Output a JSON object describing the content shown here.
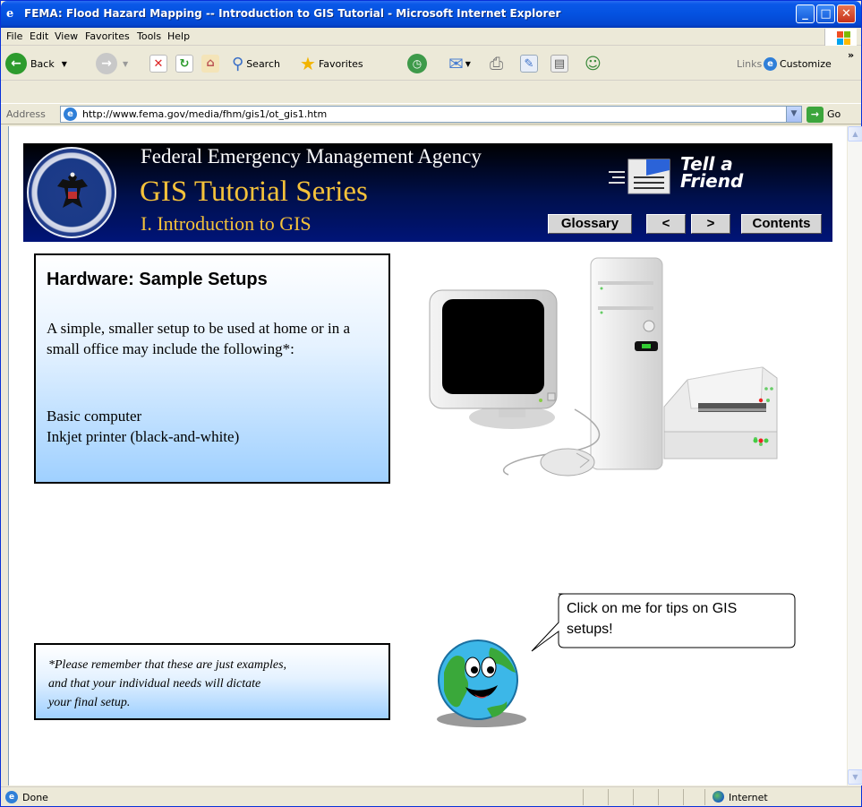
{
  "window": {
    "title": "FEMA: Flood Hazard Mapping -- Introduction to GIS Tutorial - Microsoft Internet Explorer"
  },
  "menu": {
    "items": [
      "File",
      "Edit",
      "View",
      "Favorites",
      "Tools",
      "Help"
    ]
  },
  "toolbar": {
    "back_label": "Back",
    "search_label": "Search",
    "favorites_label": "Favorites",
    "links_label": "Links",
    "customize_label": "Customize",
    "chevron": "»"
  },
  "address": {
    "label": "Address",
    "url": "http://www.fema.gov/media/fhm/gis1/ot_gis1.htm",
    "go_label": "Go"
  },
  "banner": {
    "agency": "Federal Emergency Management Agency",
    "series": "GIS Tutorial Series",
    "section": "I. Introduction to GIS",
    "tell_friend_line1": "Tell a",
    "tell_friend_line2": "Friend",
    "nav": {
      "glossary": "Glossary",
      "prev": "<",
      "next": ">",
      "contents": "Contents"
    }
  },
  "main": {
    "heading": "Hardware: Sample Setups",
    "intro": "A simple, smaller setup to be used at home or in a small office may include the following*:",
    "items": [
      "Basic computer",
      "Inkjet printer (black-and-white)"
    ]
  },
  "note": {
    "lines": [
      "*Please remember that these are just examples,",
      "and that your individual needs will dictate",
      "your final setup."
    ]
  },
  "speech": {
    "text": "Click on me for tips on GIS setups!"
  },
  "status": {
    "text": "Done",
    "zone": "Internet"
  },
  "colors": {
    "title_bar": "#0452e0",
    "banner_gold": "#f5c23a",
    "box_gradient_end": "#9fd0ff"
  }
}
